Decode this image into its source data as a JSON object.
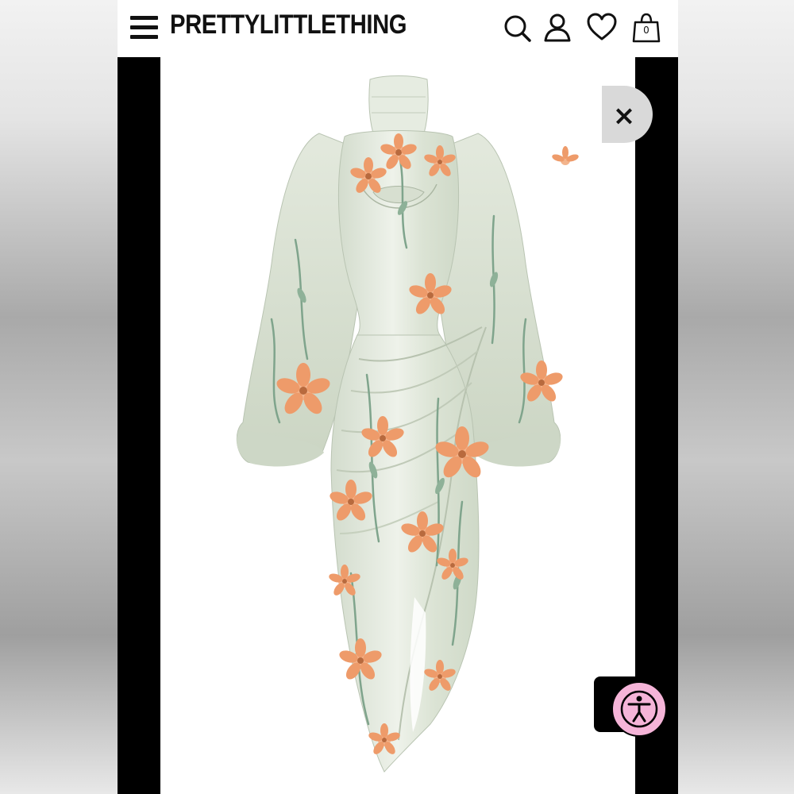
{
  "header": {
    "brand": "PRETTYLITTLETHING",
    "menu_icon": "hamburger-menu-icon",
    "search_icon": "search-icon",
    "account_icon": "user-icon",
    "wishlist_icon": "heart-icon",
    "cart_icon": "shopping-bag-icon",
    "cart_count": "0"
  },
  "product_viewer": {
    "image": "sage floral print satin draped midi dress with high neck and balloon sleeves",
    "close_icon": "close-icon",
    "close_label": "×"
  },
  "accessibility": {
    "icon": "accessibility-person-icon",
    "color": "#f5b4d8"
  },
  "colors": {
    "dress_base": "#dfe6d8",
    "flower": "#ee9b6a",
    "leaf": "#7fa48c"
  }
}
